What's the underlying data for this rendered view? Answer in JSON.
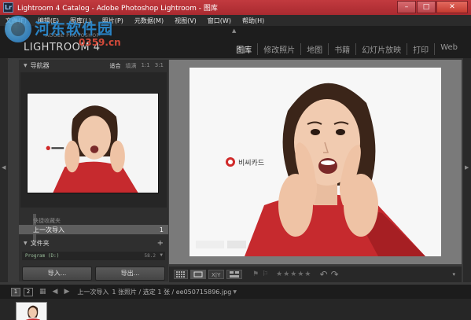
{
  "window": {
    "title": "Lightroom 4 Catalog - Adobe Photoshop Lightroom - 图库",
    "app_icon_label": "Lr",
    "controls": {
      "minimize": "–",
      "maximize": "□",
      "close": "✕"
    }
  },
  "menu": [
    "文件(F)",
    "编辑(E)",
    "图库(L)",
    "照片(P)",
    "元数据(M)",
    "视图(V)",
    "窗口(W)",
    "帮助(H)"
  ],
  "watermark": {
    "site": "河东软件园",
    "url": "0359.cn"
  },
  "identity": {
    "brand_small": "ADOBE PHOTOSHOP",
    "brand_big": "LIGHTROOM 4",
    "modules": [
      {
        "label": "图库",
        "active": true
      },
      {
        "label": "修改照片",
        "active": false
      },
      {
        "label": "地图",
        "active": false
      },
      {
        "label": "书籍",
        "active": false
      },
      {
        "label": "幻灯片放映",
        "active": false
      },
      {
        "label": "打印",
        "active": false
      },
      {
        "label": "Web",
        "active": false
      }
    ]
  },
  "navigator": {
    "title": "导航器",
    "zoom": [
      {
        "label": "适合",
        "selected": true
      },
      {
        "label": "填满",
        "selected": false
      },
      {
        "label": "1:1",
        "selected": false
      },
      {
        "label": "3:1",
        "selected": false
      }
    ]
  },
  "catalog": {
    "partial_header": "快捷收藏夹",
    "selected_item": {
      "label": "上一次导入",
      "count": "1"
    }
  },
  "folders": {
    "title": "文件夹",
    "add": "+",
    "volume": {
      "name": "Program (D:)",
      "size": "58.2"
    }
  },
  "buttons": {
    "import": "导入...",
    "export": "导出..."
  },
  "photo_card": {
    "brand_text": "비씨카드"
  },
  "toolbar": {
    "stars": "★★★★★",
    "rotate_left": "↶",
    "rotate_right": "↷",
    "menu": "▾"
  },
  "filmstrip": {
    "pages": [
      "1",
      "2"
    ],
    "source": "上一次导入",
    "info": "1 张照片 / 选定 1 张 / ee050715896.jpg"
  },
  "colors": {
    "accent_title": "#c23a3f",
    "panel_bg": "#2f2f2f"
  }
}
